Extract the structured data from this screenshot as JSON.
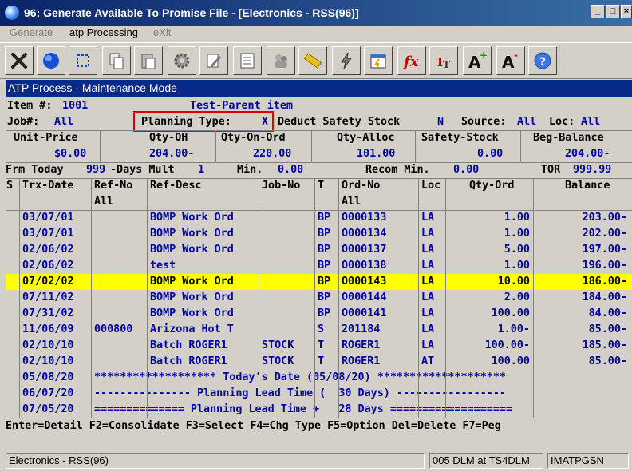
{
  "window": {
    "title": "96: Generate Available To Promise File - [Electronics - RSS(96)]",
    "min": "_",
    "max": "□",
    "close": "×"
  },
  "menu": [
    {
      "label": "Generate",
      "enabled": false
    },
    {
      "label": "atp Processing",
      "enabled": true
    },
    {
      "label": "eXit",
      "enabled": false
    }
  ],
  "toolbar_icons": [
    "exit-icon",
    "globe-icon",
    "select-icon",
    "copy-icon",
    "paste-icon",
    "settings-icon",
    "edit-icon",
    "list-icon",
    "users-icon",
    "ruler-icon",
    "lightning-icon",
    "calendar-icon",
    "fx-icon",
    "font-size-icon",
    "font-grow-icon",
    "font-shrink-icon",
    "help-icon"
  ],
  "screen": {
    "mode": "ATP Process - Maintenance Mode",
    "item_label": "Item #:",
    "item_value": "1001",
    "item_desc": "Test-Parent item",
    "job_label": "Job#:",
    "job_value": "All",
    "planning_label": "Planning Type:",
    "planning_value": "X",
    "deduct_label": "Deduct Safety Stock",
    "deduct_value": "N",
    "source_label": "Source:",
    "source_value": "All",
    "loc_label": "Loc:",
    "loc_value": "All",
    "summary_headers": [
      "Unit-Price",
      "Qty-OH",
      "Qty-On-Ord",
      "Qty-Alloc",
      "Safety-Stock",
      "Beg-Balance"
    ],
    "summary_values": [
      "$0.00",
      "204.00-",
      "220.00",
      "101.00",
      "0.00",
      "204.00-"
    ],
    "frm_today_label": "Frm Today",
    "days_value": "999",
    "days_label": "-Days Mult",
    "mult_value": "1",
    "min_label": "Min.",
    "min_value": "0.00",
    "recom_label": "Recom Min.",
    "recom_value": "0.00",
    "tor_label": "TOR",
    "tor_value": "999.99",
    "columns": [
      "S",
      "Trx-Date",
      "Ref-No",
      "Ref-Desc",
      "Job-No",
      "T",
      "Ord-No",
      "Loc",
      "Qty-Ord",
      "Balance"
    ],
    "refno_filter": "All",
    "ordno_filter": "All",
    "rows": [
      {
        "s": "",
        "date": "03/07/01",
        "refno": "",
        "desc": "BOMP Work Ord",
        "job": "",
        "t": "BP",
        "ord": "O000133",
        "loc": "LA",
        "qty": "1.00",
        "bal": "203.00-"
      },
      {
        "s": "",
        "date": "03/07/01",
        "refno": "",
        "desc": "BOMP Work Ord",
        "job": "",
        "t": "BP",
        "ord": "O000134",
        "loc": "LA",
        "qty": "1.00",
        "bal": "202.00-"
      },
      {
        "s": "",
        "date": "02/06/02",
        "refno": "",
        "desc": "BOMP Work Ord",
        "job": "",
        "t": "BP",
        "ord": "O000137",
        "loc": "LA",
        "qty": "5.00",
        "bal": "197.00-"
      },
      {
        "s": "",
        "date": "02/06/02",
        "refno": "",
        "desc": "test",
        "job": "",
        "t": "BP",
        "ord": "O000138",
        "loc": "LA",
        "qty": "1.00",
        "bal": "196.00-"
      },
      {
        "s": "",
        "date": "07/02/02",
        "refno": "",
        "desc": "BOMP Work Ord",
        "job": "",
        "t": "BP",
        "ord": "O000143",
        "loc": "LA",
        "qty": "10.00",
        "bal": "186.00-",
        "highlight": true
      },
      {
        "s": "",
        "date": "07/11/02",
        "refno": "",
        "desc": "BOMP Work Ord",
        "job": "",
        "t": "BP",
        "ord": "O000144",
        "loc": "LA",
        "qty": "2.00",
        "bal": "184.00-"
      },
      {
        "s": "",
        "date": "07/31/02",
        "refno": "",
        "desc": "BOMP Work Ord",
        "job": "",
        "t": "BP",
        "ord": "O000141",
        "loc": "LA",
        "qty": "100.00",
        "bal": "84.00-"
      },
      {
        "s": "",
        "date": "11/06/09",
        "refno": "000800",
        "desc": "Arizona Hot T",
        "job": "",
        "t": "S",
        "ord": "201184",
        "loc": "LA",
        "qty": "1.00-",
        "bal": "85.00-"
      },
      {
        "s": "",
        "date": "02/10/10",
        "refno": "",
        "desc": "Batch ROGER1",
        "job": "STOCK",
        "t": "T",
        "ord": "ROGER1",
        "loc": "LA",
        "qty": "100.00-",
        "bal": "185.00-"
      },
      {
        "s": "",
        "date": "02/10/10",
        "refno": "",
        "desc": "Batch ROGER1",
        "job": "STOCK",
        "t": "T",
        "ord": "ROGER1",
        "loc": "AT",
        "qty": "100.00",
        "bal": "85.00-"
      }
    ],
    "special_rows": [
      {
        "date": "05/08/20",
        "text": "******************* Today's Date (05/08/20) ********************"
      },
      {
        "date": "06/07/20",
        "text": "--------------- Planning Lead Time (  30 Days) -----------------"
      },
      {
        "date": "07/05/20",
        "text": "============== Planning Lead Time +   28 Days ==================="
      }
    ],
    "function_keys": "Enter=Detail F2=Consolidate F3=Select F4=Chg Type F5=Option Del=Delete F7=Peg"
  },
  "statusbar": {
    "company": "Electronics - RSS(96)",
    "session": "005 DLM at TS4DLM",
    "program": "IMATPGSN"
  }
}
